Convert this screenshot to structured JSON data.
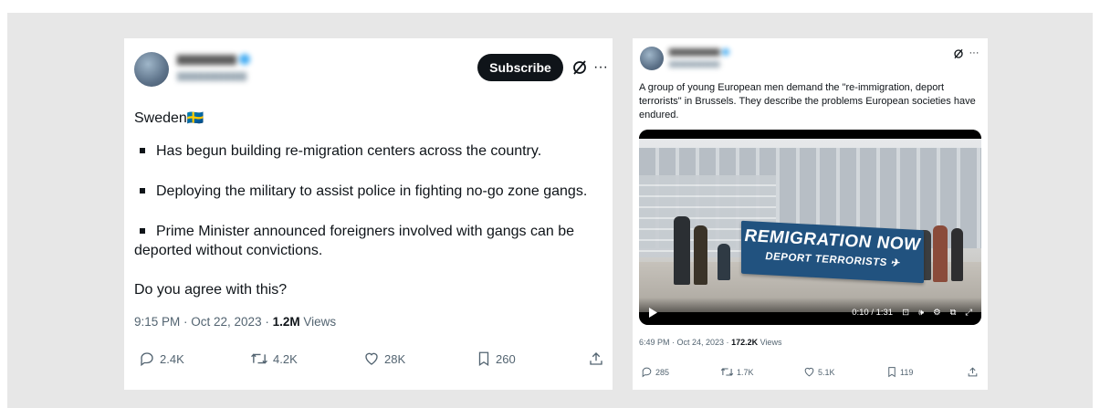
{
  "post1": {
    "subscribe_label": "Subscribe",
    "body_first": "Sweden",
    "flag": "🇸🇪",
    "bullets": [
      "Has begun building re-migration centers across the country.",
      "Deploying the military to assist police in fighting no-go zone gangs.",
      "Prime Minister announced foreigners involved with gangs can be",
      "deported without convictions."
    ],
    "question": "Do you agree with this?",
    "meta_time": "9:15 PM · Oct 22, 2023 · ",
    "views_count": "1.2M",
    "views_label": " Views",
    "stats": {
      "replies": "2.4K",
      "reposts": "4.2K",
      "likes": "28K",
      "bookmarks": "260"
    }
  },
  "post2": {
    "text": "A group of young European men demand the \"re-immigration, deport terrorists\" in Brussels. They describe the problems European societies have endured.",
    "banner_line1": "REMIGRATION NOW",
    "banner_line2": "DEPORT TERRORISTS",
    "video_time": "0:10 / 1:31",
    "meta_time": "6:49 PM · Oct 24, 2023 · ",
    "views_count": "172.2K",
    "views_label": " Views",
    "stats": {
      "replies": "285",
      "reposts": "1.7K",
      "likes": "5.1K",
      "bookmarks": "119"
    }
  },
  "colors": {
    "accent": "#1d9bf0",
    "muted": "#536471",
    "banner": "#21527f"
  },
  "icons": [
    "grok-icon",
    "more-icon",
    "reply-icon",
    "repost-icon",
    "like-icon",
    "bookmark-icon",
    "share-icon",
    "play-icon",
    "cc-icon",
    "volume-icon",
    "settings-icon",
    "pip-icon",
    "fullscreen-icon",
    "plane-icon",
    "verified-badge-icon"
  ]
}
